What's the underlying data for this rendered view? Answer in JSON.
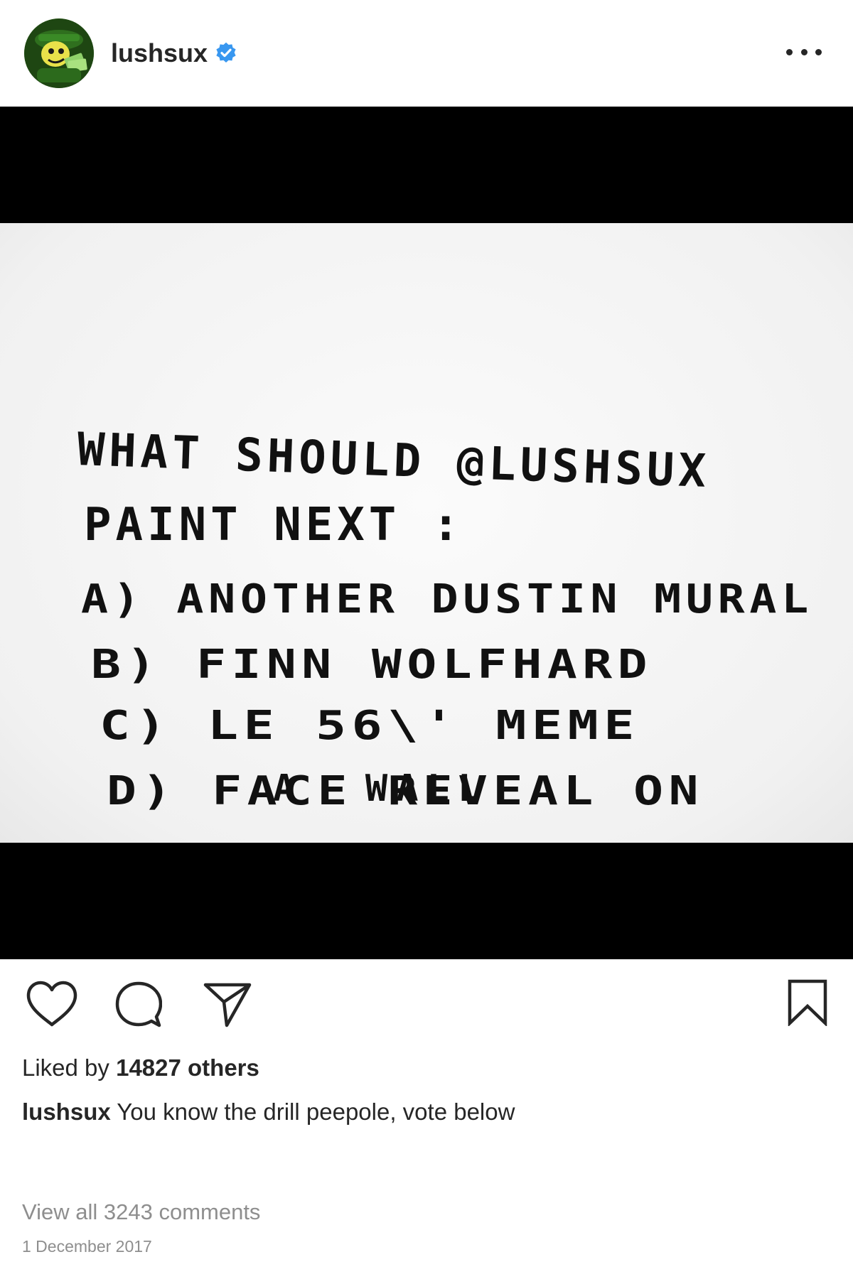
{
  "header": {
    "username": "lushsux",
    "verified": true,
    "more_icon": "more-horizontal-icon"
  },
  "media": {
    "lines": [
      "WHAT SHOULD @LUSHSUX",
      "PAINT NEXT :",
      "A)  ANOTHER DUSTIN MURAL",
      "B)  FINN  WOLFHARD",
      "C)   LE   56\\'  MEME",
      "D)   FACE  REVEAL  ON",
      "A  WALL"
    ]
  },
  "actions": {
    "like_icon": "heart-icon",
    "comment_icon": "comment-icon",
    "share_icon": "send-icon",
    "save_icon": "bookmark-icon"
  },
  "likes": {
    "prefix": "Liked by ",
    "count": "14827 others"
  },
  "caption": {
    "username": "lushsux",
    "text": " You know the drill peepole, vote below"
  },
  "comments_link": "View all 3243 comments",
  "date": "1 December 2017",
  "colors": {
    "text": "#262626",
    "muted": "#8e8e8e",
    "verified_blue": "#3897f0"
  }
}
